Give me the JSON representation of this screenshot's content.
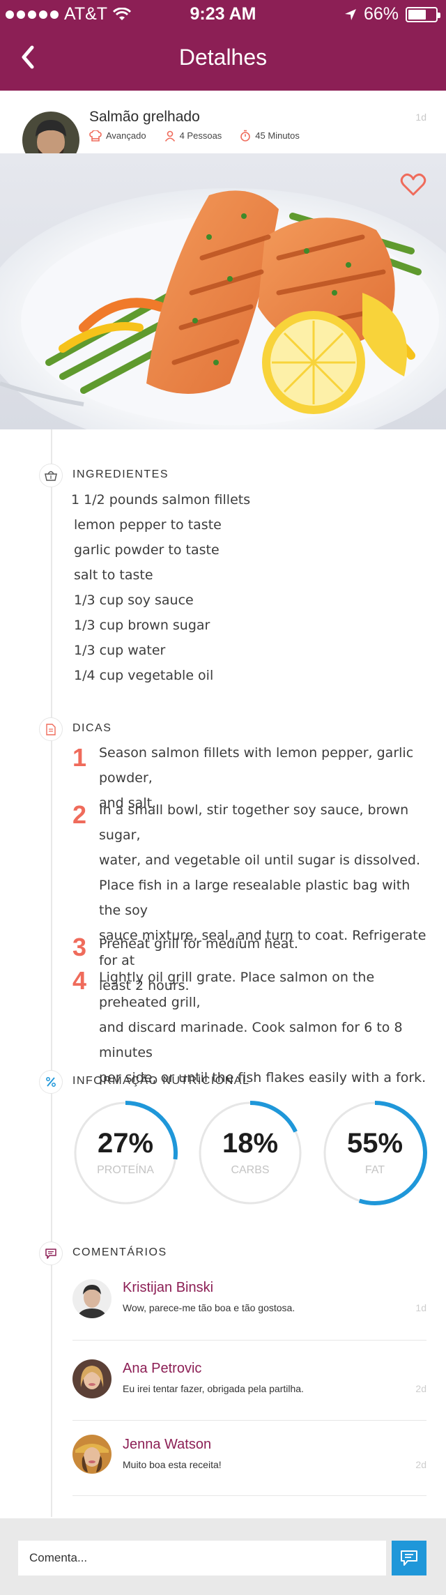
{
  "status_bar": {
    "carrier": "AT&T",
    "time": "9:23 AM",
    "battery": "66%",
    "battery_level": 0.66
  },
  "nav": {
    "title": "Detalhes",
    "back_icon": "chevron-left-icon"
  },
  "post": {
    "title": "Salmão grelhado",
    "difficulty": "Avançado",
    "servings": "4 Pessoas",
    "duration": "45 Minutos",
    "age": "1d"
  },
  "sections": {
    "ingredients": "INGREDIENTES",
    "tips": "DICAS",
    "nutrition": "INFORMAÇÃO NUTRICIONAL",
    "comments": "COMENTÁRIOS"
  },
  "ingredients": [
    "1 1/2 pounds salmon fillets",
    "lemon pepper to taste",
    "garlic powder to taste",
    "salt to taste",
    "1/3 cup soy sauce",
    "1/3 cup brown sugar",
    "1/3 cup water",
    "1/4 cup vegetable oil"
  ],
  "steps": [
    {
      "num": "1",
      "lines": [
        "Season salmon fillets with lemon pepper, garlic powder,",
        "and salt."
      ]
    },
    {
      "num": "2",
      "lines": [
        "In a small bowl, stir together soy sauce, brown sugar,",
        "water, and vegetable oil until sugar is dissolved.",
        "Place fish in a large resealable plastic bag with the soy",
        "sauce mixture, seal, and turn to coat. Refrigerate for at",
        "least 2 hours."
      ]
    },
    {
      "num": "3",
      "lines": [
        "Preheat grill for medium heat."
      ]
    },
    {
      "num": "4",
      "lines": [
        "Lightly oil grill grate. Place salmon on the preheated grill,",
        "and discard marinade. Cook salmon for 6 to 8 minutes",
        "per side, or until the fish flakes easily with a fork."
      ]
    }
  ],
  "nutrition": [
    {
      "value": "27%",
      "label": "PROTEÍNA",
      "fraction": 0.27
    },
    {
      "value": "18%",
      "label": "CARBS",
      "fraction": 0.18
    },
    {
      "value": "55%",
      "label": "FAT",
      "fraction": 0.55
    }
  ],
  "colors": {
    "brand": "#8c1f55",
    "accent": "#1f97d9",
    "step_number": "#ef6b5b"
  },
  "comments": [
    {
      "name": "Kristijan Binski",
      "text": "Wow, parece-me tão  boa e tão gostosa.",
      "age": "1d"
    },
    {
      "name": "Ana Petrovic",
      "text": "Eu irei tentar fazer, obrigada pela partilha.",
      "age": "2d"
    },
    {
      "name": "Jenna Watson",
      "text": "Muito boa esta receita!",
      "age": "2d"
    }
  ],
  "composer": {
    "placeholder": "Comenta...",
    "send_icon": "chat-send-icon"
  }
}
